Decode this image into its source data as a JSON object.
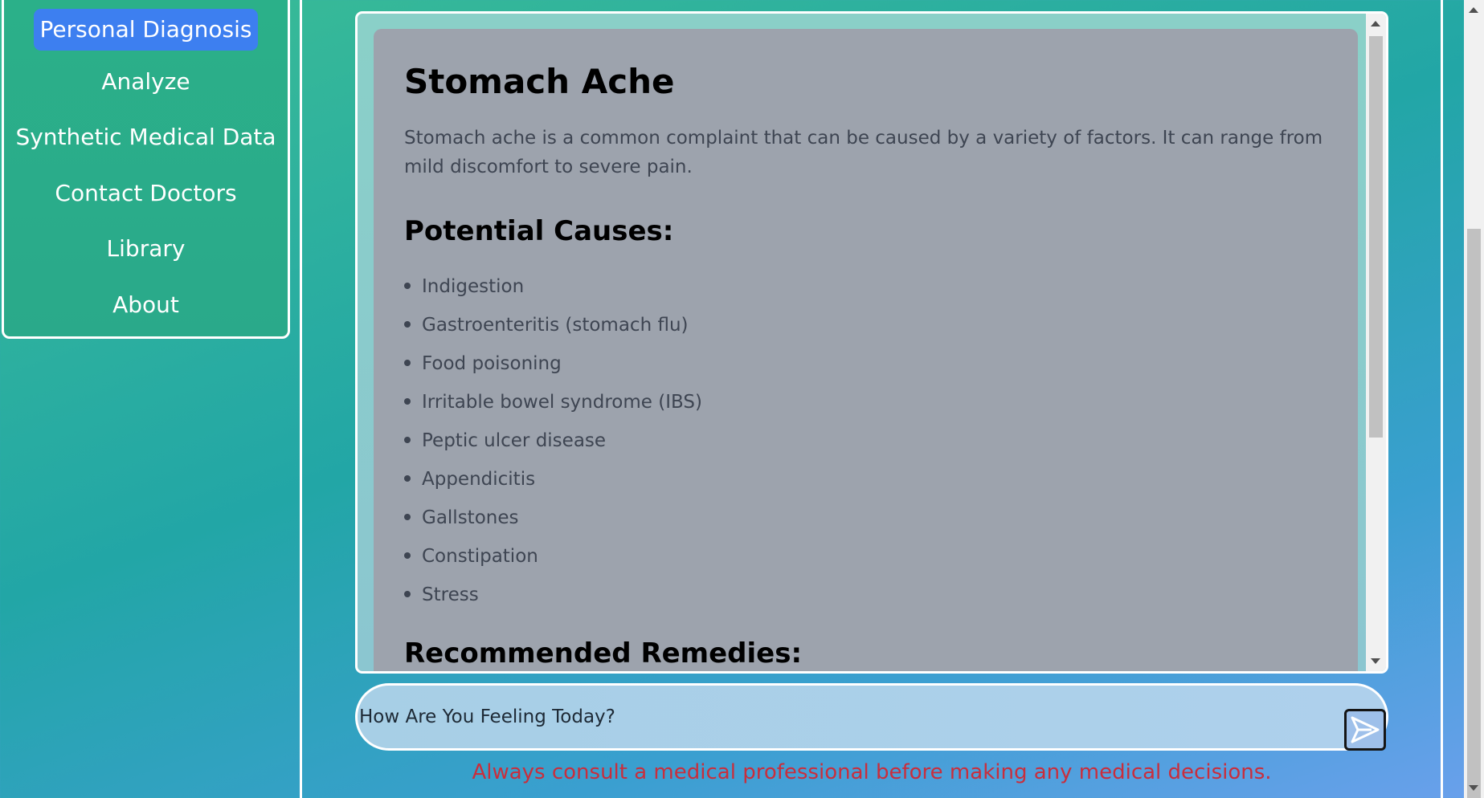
{
  "nav": {
    "items": [
      {
        "label": "Personal Diagnosis",
        "active": true
      },
      {
        "label": "Analyze"
      },
      {
        "label": "Synthetic Medical Data"
      },
      {
        "label": "Contact Doctors"
      },
      {
        "label": "Library"
      },
      {
        "label": "About"
      }
    ]
  },
  "article": {
    "title": "Stomach Ache",
    "description": "Stomach ache is a common complaint that can be caused by a variety of factors. It can range from mild discomfort to severe pain.",
    "causes_heading": "Potential Causes:",
    "causes": [
      "Indigestion",
      "Gastroenteritis (stomach flu)",
      "Food poisoning",
      "Irritable bowel syndrome (IBS)",
      "Peptic ulcer disease",
      "Appendicitis",
      "Gallstones",
      "Constipation",
      "Stress"
    ],
    "remedies_heading": "Recommended Remedies:"
  },
  "chat": {
    "input_value": "How Are You Feeling Today?",
    "send_icon": "send-icon"
  },
  "disclaimer": "Always consult a medical professional before making any medical decisions.",
  "colors": {
    "active_nav": "#3d7ff0",
    "disclaimer": "#c92e3c",
    "card_bg": "#9da3ad"
  }
}
